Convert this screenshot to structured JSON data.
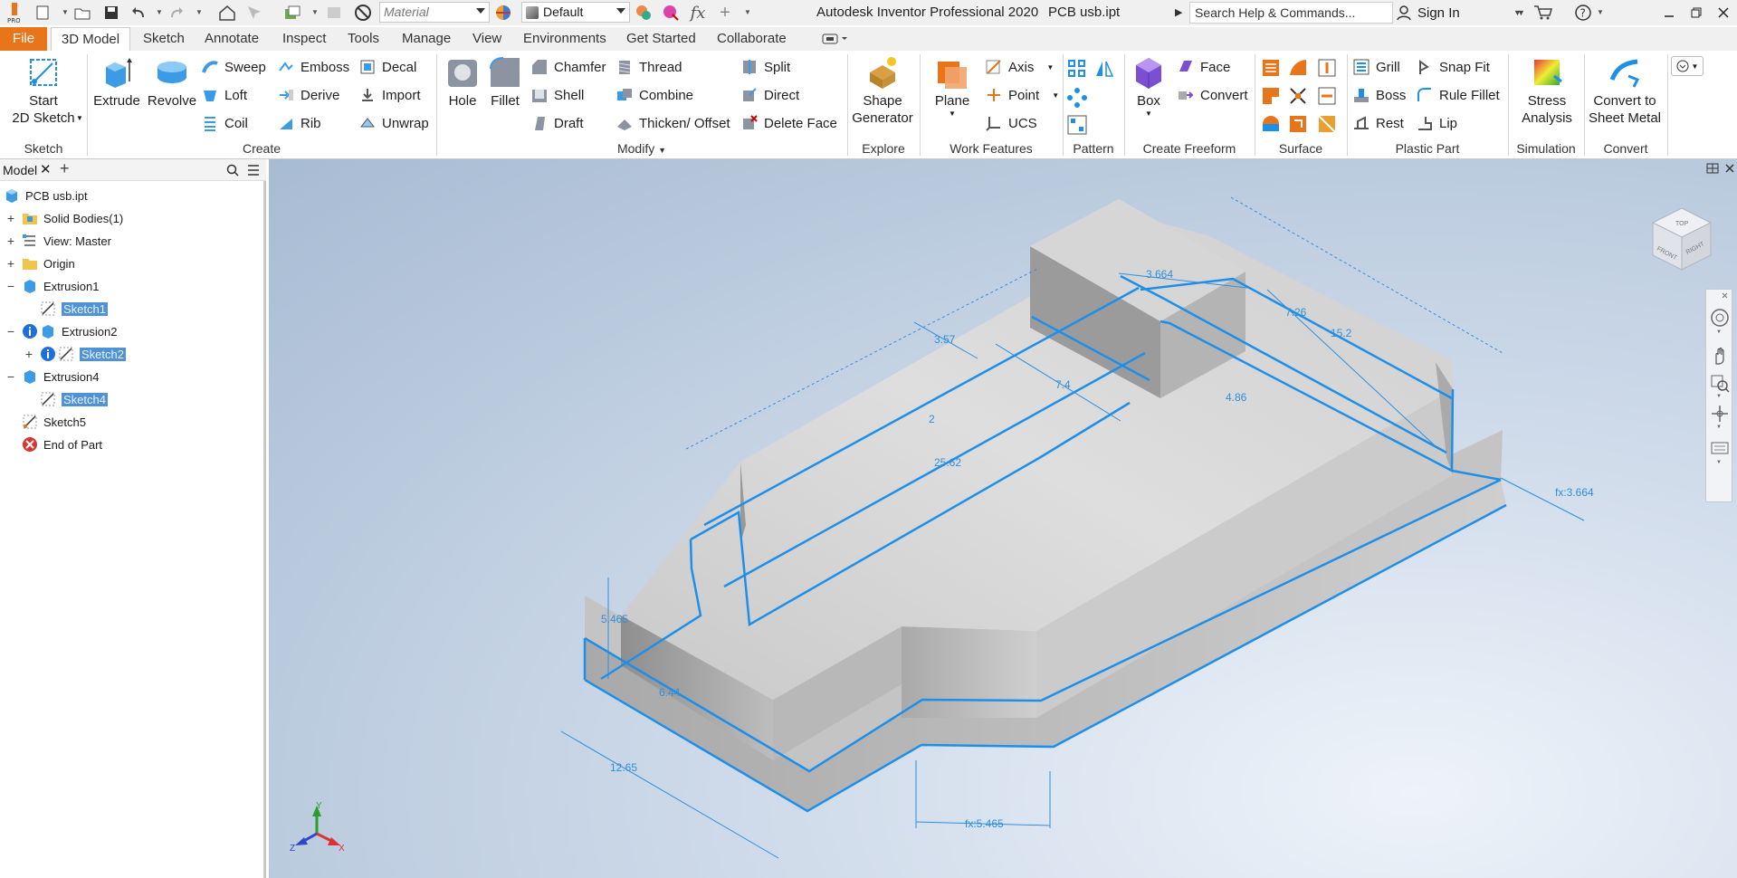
{
  "title_bar": {
    "app_title": "Autodesk Inventor Professional 2020",
    "file_title": "PCB usb.ipt",
    "material_value": "Material",
    "appearance_value": "Default",
    "search_placeholder": "Search Help & Commands...",
    "sign_in": "Sign In"
  },
  "tabs": [
    "File",
    "3D Model",
    "Sketch",
    "Annotate",
    "Inspect",
    "Tools",
    "Manage",
    "View",
    "Environments",
    "Get Started",
    "Collaborate"
  ],
  "ribbon": {
    "sketch": {
      "start_line1": "Start",
      "start_line2": "2D Sketch",
      "title": "Sketch"
    },
    "create": {
      "extrude": "Extrude",
      "revolve": "Revolve",
      "sweep": "Sweep",
      "loft": "Loft",
      "coil": "Coil",
      "emboss": "Emboss",
      "derive": "Derive",
      "rib": "Rib",
      "decal": "Decal",
      "import": "Import",
      "unwrap": "Unwrap",
      "title": "Create"
    },
    "modify": {
      "hole": "Hole",
      "fillet": "Fillet",
      "chamfer": "Chamfer",
      "shell": "Shell",
      "draft": "Draft",
      "thread": "Thread",
      "combine": "Combine",
      "thicken": "Thicken/ Offset",
      "split": "Split",
      "direct": "Direct",
      "delete_face": "Delete Face",
      "title": "Modify"
    },
    "explore": {
      "shape_line1": "Shape",
      "shape_line2": "Generator",
      "title": "Explore"
    },
    "work_features": {
      "plane": "Plane",
      "axis": "Axis",
      "point": "Point",
      "ucs": "UCS",
      "title": "Work Features"
    },
    "pattern": {
      "title": "Pattern"
    },
    "freeform": {
      "box": "Box",
      "face": "Face",
      "convert": "Convert",
      "title": "Create Freeform"
    },
    "surface": {
      "title": "Surface"
    },
    "plastic": {
      "grill": "Grill",
      "boss": "Boss",
      "rest": "Rest",
      "snap_fit": "Snap Fit",
      "rule_fillet": "Rule Fillet",
      "lip": "Lip",
      "title": "Plastic Part"
    },
    "simulation": {
      "stress_line1": "Stress",
      "stress_line2": "Analysis",
      "title": "Simulation"
    },
    "convert": {
      "sheet_line1": "Convert to",
      "sheet_line2": "Sheet Metal",
      "title": "Convert"
    }
  },
  "browser": {
    "tab_label": "Model",
    "root": "PCB usb.ipt",
    "nodes": [
      "Solid Bodies(1)",
      "View: Master",
      "Origin",
      "Extrusion1",
      "Sketch1",
      "Extrusion2",
      "Sketch2",
      "Extrusion4",
      "Sketch4",
      "Sketch5",
      "End of Part"
    ]
  },
  "viewcube": {
    "top": "TOP",
    "front": "FRONT",
    "right": "RIGHT"
  },
  "dimensions": [
    "3.664",
    "7.26",
    "15.2",
    "3.57",
    "7.4",
    "4.86",
    "2",
    "25.62",
    "5.465",
    "6.44",
    "12.65",
    "fx:3.664",
    "fx:5.465"
  ],
  "triad": {
    "x": "X",
    "y": "Y",
    "z": "Z"
  },
  "colors": {
    "accent": "#1e8fe8",
    "file_tab": "#e8751a",
    "selection": "#4f93d6"
  }
}
